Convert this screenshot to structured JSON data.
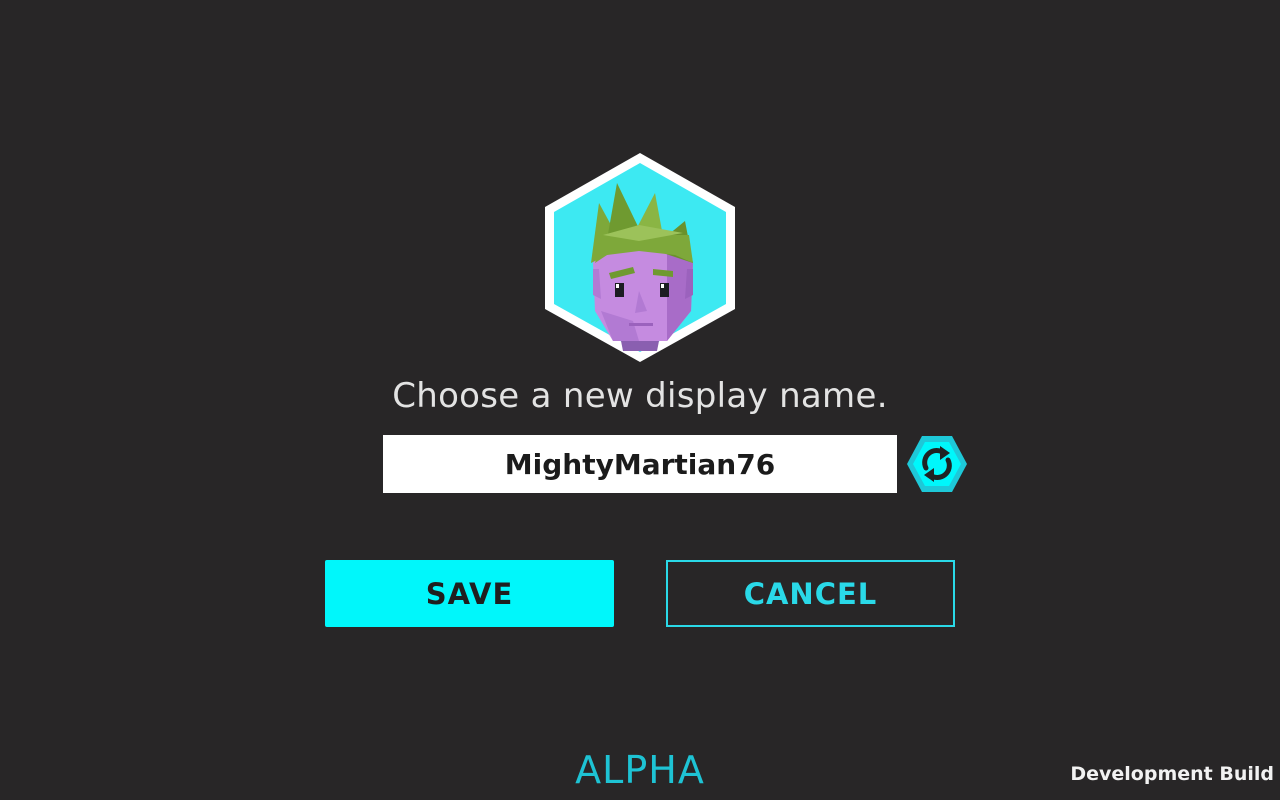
{
  "profile": {
    "avatar_icon": "alien-avatar-icon",
    "colors": {
      "badge_fill": "#3de9f2",
      "badge_border": "#ffffff",
      "skin": "#c58be0",
      "hair": "#7ea83a"
    }
  },
  "dialog": {
    "prompt": "Choose a new display name.",
    "display_name": "MightyMartian76",
    "reroll_icon": "refresh-icon",
    "save_label": "SAVE",
    "cancel_label": "CANCEL"
  },
  "footer": {
    "stage_label": "ALPHA",
    "build_label": "Development Build"
  },
  "theme": {
    "background": "#282627",
    "accent": "#00f7fb",
    "accent_outline": "#2ad9e8"
  }
}
